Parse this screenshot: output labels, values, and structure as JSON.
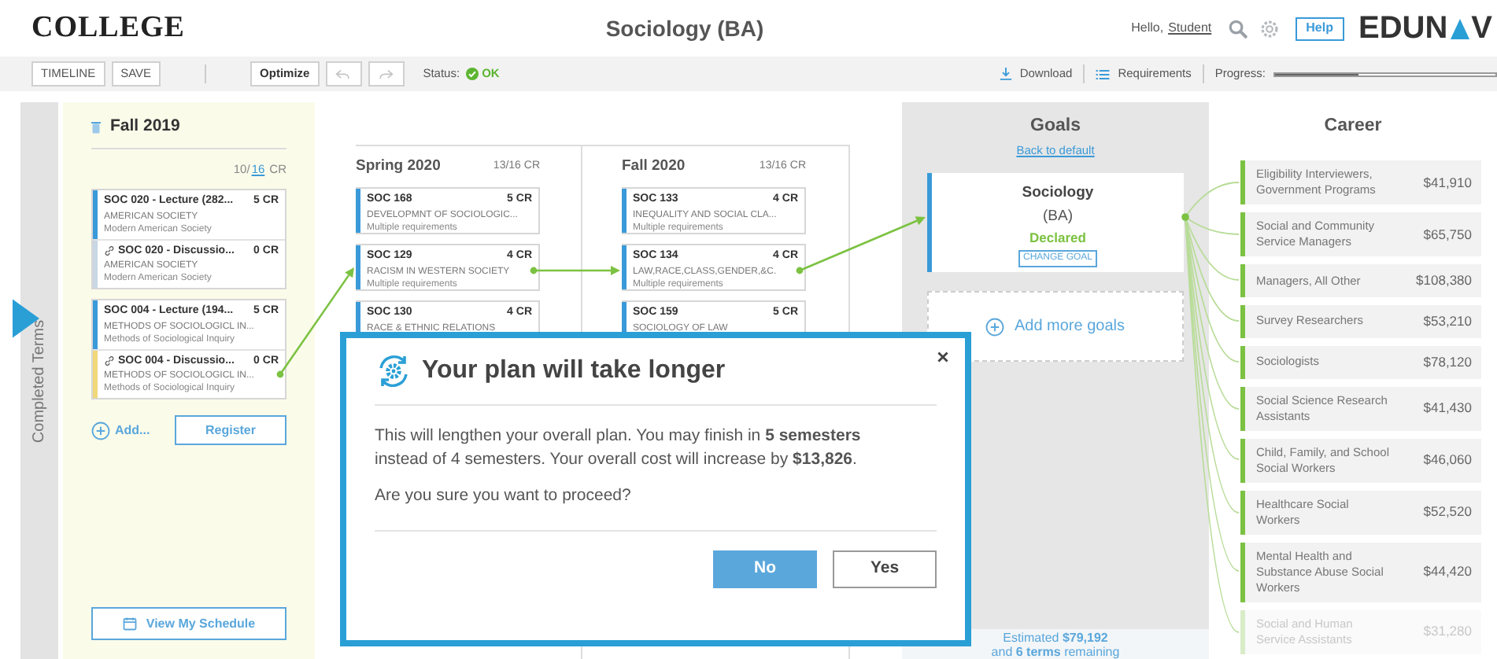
{
  "header": {
    "college": "COLLEGE",
    "program": "Sociology (BA)",
    "greeting": "Hello,",
    "user": "Student",
    "help": "Help",
    "brand_left": "EDUN",
    "brand_right": "V"
  },
  "toolbar": {
    "buttons": [
      {
        "label": "TIMELINE",
        "kind": "plain"
      },
      {
        "label": "SAVE",
        "kind": "plain"
      },
      {
        "label": "Optimize",
        "kind": "strong"
      }
    ],
    "undo": {
      "disabled": true
    },
    "redo": {
      "disabled": true
    },
    "status_label": "Status:",
    "status": "OK",
    "status_ok": true,
    "download": "Download",
    "requirements": "Requirements",
    "progress_label": "Progress:",
    "progress": {
      "level": 0.38
    }
  },
  "completed_terms": {
    "label": "Completed Terms"
  },
  "current_term": {
    "title": "Fall 2019",
    "credits": "10/",
    "credits_link": "16",
    "credits_unit": "CR",
    "groups": [
      {
        "courses": [
          {
            "code": "SOC 020 - Lecture (282...",
            "credits": "5 CR",
            "title": "AMERICAN SOCIETY",
            "requirement": "Modern American Society",
            "linked": false,
            "color": "#3a9ad9"
          },
          {
            "code": "SOC 020 - Discussio...",
            "credits": "0 CR",
            "title": "AMERICAN SOCIETY",
            "requirement": "Modern American Society",
            "linked": true,
            "color": "#c9d6e3"
          }
        ]
      },
      {
        "courses": [
          {
            "code": "SOC 004 - Lecture (194...",
            "credits": "5 CR",
            "title": "METHODS OF SOCIOLOGICL IN...",
            "requirement": "Methods of Sociological Inquiry",
            "linked": false,
            "color": "#3a9ad9"
          },
          {
            "code": "SOC 004 - Discussio...",
            "credits": "0 CR",
            "title": "METHODS OF SOCIOLOGICL IN...",
            "requirement": "Methods of Sociological Inquiry",
            "linked": true,
            "color": "#f0d77a"
          }
        ]
      }
    ],
    "add": "Add...",
    "register": "Register",
    "schedule": "View My Schedule"
  },
  "terms": [
    {
      "title": "Spring 2020",
      "credits": "13/16 CR",
      "courses": [
        {
          "code": "SOC 168",
          "credits": "5 CR",
          "title": "DEVELOPMNT OF SOCIOLOGIC...",
          "requirement": "Multiple requirements",
          "linked": false,
          "color": "#3a9ad9"
        },
        {
          "code": "SOC 129",
          "credits": "4 CR",
          "title": "RACISM IN WESTERN SOCIETY",
          "requirement": "Multiple requirements",
          "linked": false,
          "color": "#3a9ad9"
        },
        {
          "code": "SOC 130",
          "credits": "4 CR",
          "title": "RACE & ETHNIC RELATIONS",
          "linked": false,
          "color": "#3a9ad9"
        }
      ]
    },
    {
      "title": "Fall 2020",
      "credits": "13/16 CR",
      "courses": [
        {
          "code": "SOC 133",
          "credits": "4 CR",
          "title": "INEQUALITY AND SOCIAL CLA...",
          "requirement": "Multiple requirements",
          "linked": false,
          "color": "#3a9ad9"
        },
        {
          "code": "SOC 134",
          "credits": "4 CR",
          "title": "LAW,RACE,CLASS,GENDER,&C.",
          "requirement": "Multiple requirements",
          "linked": false,
          "color": "#3a9ad9"
        },
        {
          "code": "SOC 159",
          "credits": "5 CR",
          "title": "SOCIOLOGY OF LAW",
          "linked": false,
          "color": "#3a9ad9"
        }
      ]
    }
  ],
  "goals": {
    "title": "Goals",
    "reset": "Back to default",
    "goal": {
      "name": "Sociology",
      "degree": "(BA)",
      "status": "Declared",
      "change": "CHANGE GOAL"
    },
    "add": "Add more goals",
    "estimate_line1": "Estimated **$79,192**",
    "estimate_line2": "and **6 terms** remaining"
  },
  "career": {
    "title": "Career",
    "jobs": [
      {
        "title": "Eligibility Interviewers, Government Programs",
        "salary": "$41,910",
        "faded": false
      },
      {
        "title": "Social and Community Service Managers",
        "salary": "$65,750",
        "faded": false
      },
      {
        "title": "Managers, All Other",
        "salary": "$108,380",
        "faded": false
      },
      {
        "title": "Survey Researchers",
        "salary": "$53,210",
        "faded": false
      },
      {
        "title": "Sociologists",
        "salary": "$78,120",
        "faded": false
      },
      {
        "title": "Social Science Research Assistants",
        "salary": "$41,430",
        "faded": false
      },
      {
        "title": "Child, Family, and School Social Workers",
        "salary": "$46,060",
        "faded": false
      },
      {
        "title": "Healthcare Social Workers",
        "salary": "$52,520",
        "faded": false
      },
      {
        "title": "Mental Health and Substance Abuse Social Workers",
        "salary": "$44,420",
        "faded": false
      },
      {
        "title": "Social and Human Service Assistants",
        "salary": "$31,280",
        "faded": true
      }
    ]
  },
  "dialog": {
    "title": "Your plan will take longer",
    "body": "This will lengthen your overall plan. You may finish in **5 semesters** instead of 4 semesters. Your overall cost will increase by **$13,826**.",
    "question": "Are you sure you want to proceed?",
    "buttons": [
      {
        "label": "No",
        "kind": "primary"
      },
      {
        "label": "Yes",
        "kind": "secondary"
      }
    ]
  }
}
